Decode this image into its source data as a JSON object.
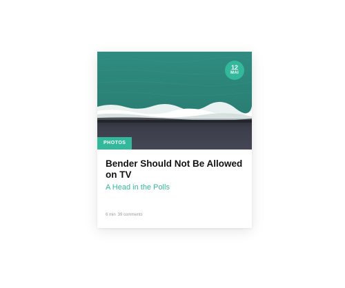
{
  "card": {
    "date": {
      "day": "12",
      "month": "MAI"
    },
    "category": "PHOTOS",
    "title": "Bender Should Not Be Allowed on TV",
    "subtitle": "A Head in the Polls",
    "meta": {
      "read_time": "6 min",
      "comments": "39 comments"
    },
    "image": {
      "icon": "aerial-beach-photo",
      "ocean_color": "#2a7f73",
      "sand_color": "#3b3d4a"
    }
  },
  "colors": {
    "accent": "#33b89b",
    "title": "#111111",
    "meta": "#9a9a9a"
  }
}
